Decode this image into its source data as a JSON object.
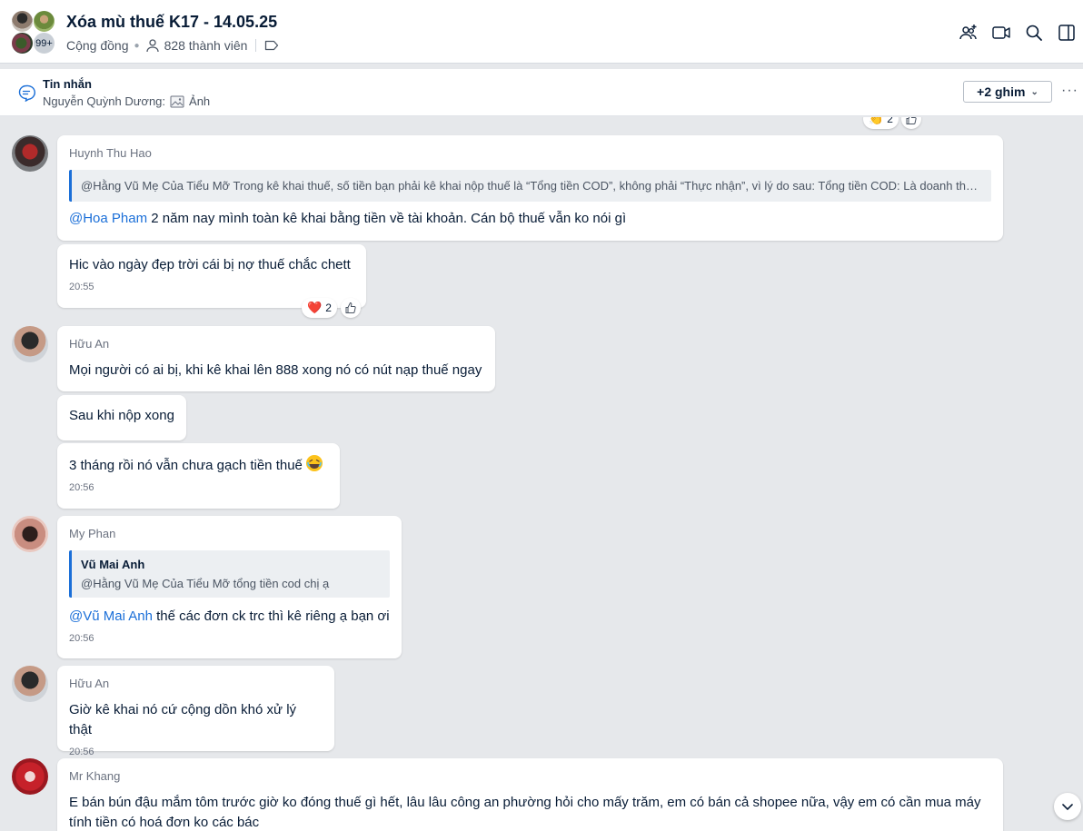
{
  "header": {
    "title": "Xóa mù thuế K17 - 14.05.25",
    "type_label": "Cộng đồng",
    "members_label": "828 thành viên",
    "avatar_overflow": "99+"
  },
  "pinned": {
    "title": "Tin nhắn",
    "sender": "Nguyễn Quỳnh Dương:",
    "content": "Ảnh",
    "more_pins": "+2 ghim"
  },
  "top_reaction": {
    "emoji": "👏",
    "count": "2"
  },
  "messages": [
    {
      "sender": "Huynh Thu Hao",
      "quote": "@Hằng Vũ Mẹ Của Tiểu Mỡ Trong kê khai thuế, số tiền bạn phải kê khai nộp thuế là “Tổng tiền COD”, không phải “Thực nhận”, vì lý do sau: Tổng tiền COD: Là doanh thu ...",
      "mention": "@Hoa Pham",
      "text": " 2 năm nay mình toàn kê khai bằng tiền về tài khoản. Cán bộ thuế vẫn ko nói gì"
    },
    {
      "text": "Hic vào ngày đẹp trời cái bị nợ thuế chắc chett",
      "time": "20:55",
      "reaction_emoji": "❤️",
      "reaction_count": "2"
    },
    {
      "sender": "Hữu An",
      "text": "Mọi người có ai bị, khi kê khai lên 888 xong nó có nút nạp thuế ngay"
    },
    {
      "text": "Sau khi nộp xong"
    },
    {
      "text": "3 tháng rồi nó vẫn chưa gạch tiền thuế",
      "time": "20:56"
    },
    {
      "sender": "My Phan",
      "quote_name": "Vũ Mai Anh",
      "quote": "@Hằng Vũ Mẹ Của Tiểu Mỡ tổng tiền cod chị ạ",
      "mention": "@Vũ Mai Anh",
      "text": " thế các đơn ck trc thì kê riêng ạ bạn ơi",
      "time": "20:56"
    },
    {
      "sender": "Hữu An",
      "text": "Giờ kê khai nó cứ cộng dồn khó xử lý thật",
      "time": "20:56"
    },
    {
      "sender": "Mr Khang",
      "text": "E bán bún đậu mắm tôm trước giờ ko đóng thuế gì hết, lâu lâu công an phường hỏi cho mấy trăm, em có bán cả shopee nữa, vậy em có cần mua máy tính tiền có hoá đơn ko các bác"
    }
  ],
  "icons": {
    "header": [
      "add-member-icon",
      "video-call-icon",
      "search-icon",
      "side-panel-icon"
    ],
    "pin": "message-icon",
    "image": "image-icon",
    "like": "thumbs-up-icon",
    "scroll": "chevron-down-icon"
  },
  "colors": {
    "accent": "#1b6fd8",
    "text": "#081c36",
    "background": "#e6e8eb"
  }
}
